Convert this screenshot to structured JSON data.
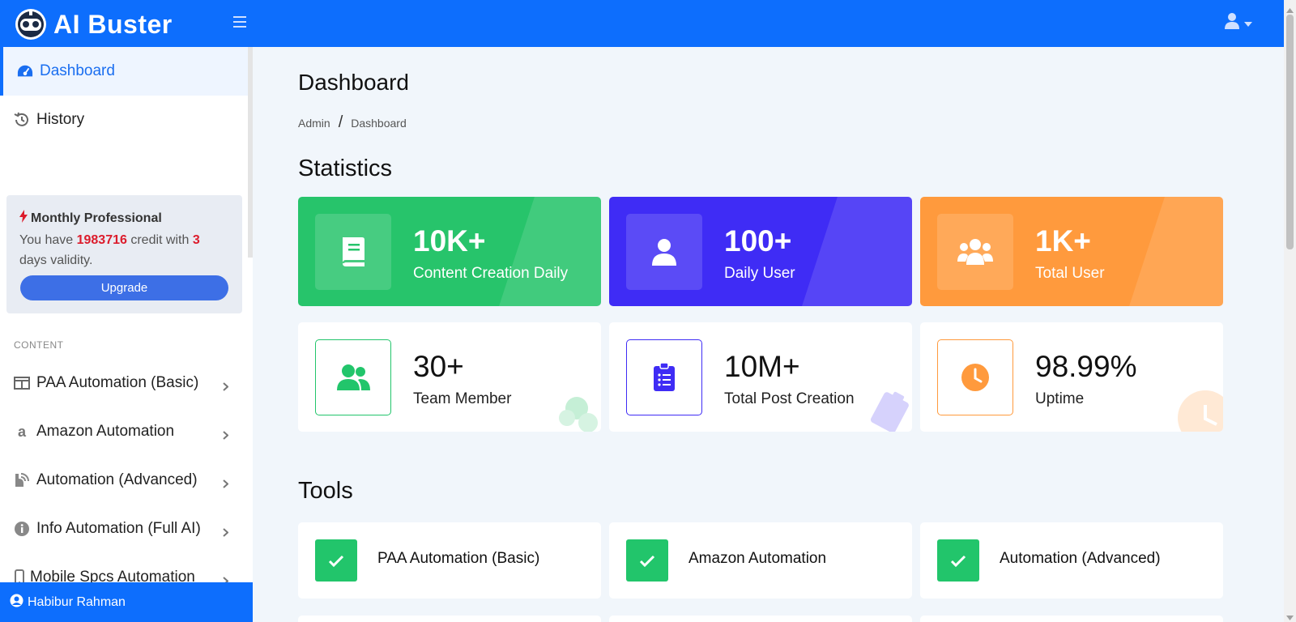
{
  "app": {
    "name": "AI Buster"
  },
  "sidebar": {
    "items": [
      {
        "label": "Dashboard",
        "icon": "gauge-icon"
      },
      {
        "label": "History",
        "icon": "history-icon"
      }
    ],
    "plan": {
      "title": "Monthly Professional",
      "text_prefix": "You have",
      "credits": "1983716",
      "text_mid": "credit with",
      "days": "3",
      "text_suffix": "days validity.",
      "upgrade_label": "Upgrade"
    },
    "section_label": "CONTENT",
    "content_items": [
      {
        "label": "PAA Automation (Basic)",
        "icon": "columns-icon"
      },
      {
        "label": "Amazon Automation",
        "icon": "amazon-icon"
      },
      {
        "label": "Automation (Advanced)",
        "icon": "blogger-icon"
      },
      {
        "label": "Info Automation (Full AI)",
        "icon": "info-icon"
      },
      {
        "label": "Mobile Spcs Automation",
        "icon": "mobile-icon"
      }
    ],
    "footer_user": "Habibur Rahman"
  },
  "main": {
    "title": "Dashboard",
    "breadcrumb": [
      "Admin",
      "Dashboard"
    ],
    "stats_heading": "Statistics",
    "stats": [
      {
        "value": "10K+",
        "label": "Content Creation Daily",
        "color": "#27c46b"
      },
      {
        "value": "100+",
        "label": "Daily User",
        "color": "#3f2cf5"
      },
      {
        "value": "1K+",
        "label": "Total User",
        "color": "#ff9a3d"
      },
      {
        "value": "30+",
        "label": "Team Member",
        "color": "#22c56b"
      },
      {
        "value": "10M+",
        "label": "Total Post Creation",
        "color": "#3f2cf5"
      },
      {
        "value": "98.99%",
        "label": "Uptime",
        "color": "#ff9a3d"
      }
    ],
    "tools_heading": "Tools",
    "tools": [
      {
        "label": "PAA Automation (Basic)"
      },
      {
        "label": "Amazon Automation"
      },
      {
        "label": "Automation (Advanced)"
      }
    ]
  },
  "colors": {
    "primary": "#0d6efd",
    "green": "#27c46b",
    "purple": "#3f2cf5",
    "orange": "#ff9a3d",
    "danger": "#dc1c2c"
  }
}
